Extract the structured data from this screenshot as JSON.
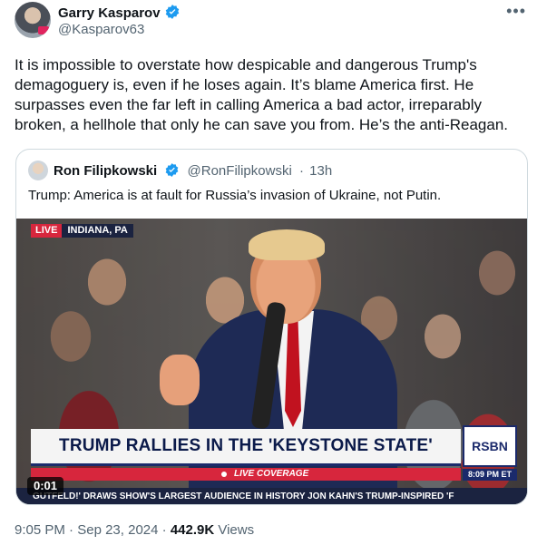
{
  "author": {
    "name": "Garry Kasparov",
    "handle": "@Kasparov63"
  },
  "tweet_text": "It is impossible to overstate how despicable and dangerous Trump's demagoguery is, even if he loses again. It’s blame America first. He surpasses even the far left in calling America a bad actor, irreparably broken, a hellhole that only he can save you from. He’s the anti-Reagan.",
  "more_icon": "more-horizontal-icon",
  "quoted": {
    "name": "Ron Filipkowski",
    "handle": "@RonFilipkowski",
    "separator": "·",
    "time": "13h",
    "text": "Trump: America is at fault for Russia’s invasion of Ukraine, not Putin.",
    "video": {
      "live_label": "LIVE",
      "location": "INDIANA, PA",
      "banner": "TRUMP RALLIES IN THE 'KEYSTONE STATE'",
      "live_coverage": "LIVE COVERAGE",
      "network": "RSBN",
      "clock": "8:09 PM ET",
      "ticker": "GUTFELD!' DRAWS SHOW'S LARGEST AUDIENCE IN HISTORY     JON KAHN'S TRUMP-INSPIRED 'F",
      "duration": "0:01"
    }
  },
  "footer": {
    "time": "9:05 PM",
    "separator": "·",
    "date": "Sep 23, 2024",
    "separator2": "·",
    "views_count": "442.9K",
    "views_label": "Views"
  },
  "colors": {
    "verified": "#1d9bf0",
    "text": "#0f1419",
    "secondary": "#536471",
    "border": "#cfd9de",
    "live_red": "#d7263d"
  }
}
